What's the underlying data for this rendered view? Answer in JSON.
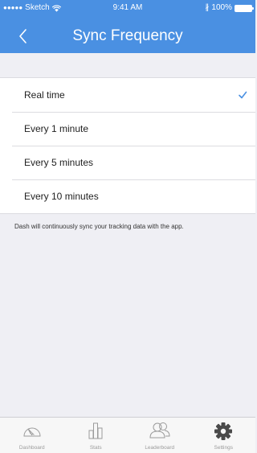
{
  "status_bar": {
    "carrier": "Sketch",
    "time": "9:41 AM",
    "battery": "100%"
  },
  "nav": {
    "title": "Sync Frequency",
    "back_icon": "chevron-left-icon"
  },
  "options": [
    {
      "label": "Real time",
      "selected": true
    },
    {
      "label": "Every 1 minute",
      "selected": false
    },
    {
      "label": "Every 5 minutes",
      "selected": false
    },
    {
      "label": "Every 10 minutes",
      "selected": false
    }
  ],
  "footnote": "Dash will continuously sync your tracking data with the app.",
  "tabs": [
    {
      "label": "Dashboard",
      "icon": "speedometer-icon"
    },
    {
      "label": "Stats",
      "icon": "bar-chart-icon"
    },
    {
      "label": "Leaderboard",
      "icon": "people-icon"
    },
    {
      "label": "Settings",
      "icon": "gear-icon",
      "active": true
    }
  ],
  "colors": {
    "accent": "#4a90e2",
    "background": "#efeff4",
    "tab_inactive": "#9b9b9b",
    "tab_active": "#4a4a4a"
  }
}
